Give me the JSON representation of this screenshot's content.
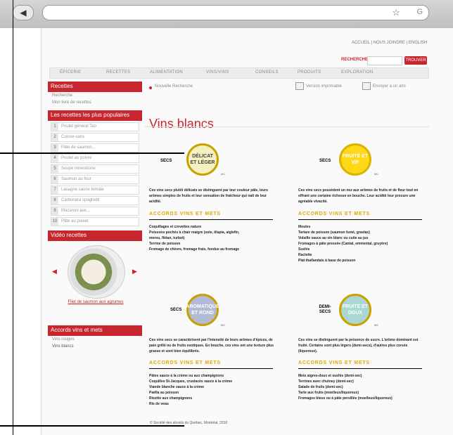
{
  "browser": {
    "back": "◀"
  },
  "header": {
    "lang": "ACCUEIL | NOUS JOINDRE | ENGLISH",
    "search_label": "RECHERCHE",
    "search_button": "TROUVER"
  },
  "nav": [
    "ÉPICERIE",
    "RECETTES",
    "ALIMENTATION",
    "VINS/VINS",
    "CONSEILS",
    "PRODUITS",
    "EXPLORATION"
  ],
  "sidebar": {
    "recettes": "Recettes",
    "links": [
      "Recherche",
      "Mon livre de recettes"
    ],
    "popular_head": "Les recettes les plus populaires",
    "popular": [
      "Poulet général Tao",
      "Cuisse-sans",
      "Pâté de saumon...",
      "Poulet au poivre",
      "Soupe minestrone",
      "Saumon au four",
      "Lasagne sauce tomate",
      "Carbonara spaghetti",
      "Macaroni aux...",
      "Pâté au poulet"
    ],
    "video_head": "Vidéo recettes",
    "video_caption": "Filet de saumon aux agrumes",
    "wines_head": "Accords vins et mets",
    "wines": [
      "Vins rouges",
      "Vins blancs"
    ]
  },
  "main": {
    "crumb": "Nouvelle Recherche",
    "print_label": "Version imprimable",
    "send_label": "Envoyer à un ami",
    "title": "Vins blancs",
    "cards": [
      {
        "type": "SECS",
        "circle": "DÉLICAT ET LÉGER",
        "circle_color": "#f5f0bf",
        "ring_color": "#c9a000",
        "text_color": "#444",
        "desc": "Ces vins secs plutôt délicats se distinguent par leur couleur pâle, leurs arômes simples de fruits et leur sensation de fraîcheur qui naît de leur acidité.",
        "section": "ACCORDS VINS ET METS",
        "items": [
          "Coquillages et crevettes nature",
          "Poissons pochés à chair maigre (sole, tilapia, aiglefin,",
          "merou, flétan, turbot)",
          "Terrine de poisson",
          "Fromage de chèvre, fromage frais, fondue au fromage"
        ]
      },
      {
        "type": "SECS",
        "circle": "FRUITÉ ET VIF",
        "circle_color": "#ffd81a",
        "ring_color": "#d9b400",
        "text_color": "#fff",
        "desc": "Ces vins secs possèdent un nez aux arômes de fruits et de fleur tout en offrant une certaine richesse en bouche. Leur acidité leur procure une agréable vivacité.",
        "section": "ACCORDS VINS ET METS",
        "items": [
          "Moules",
          "Tartare de poisson (saumon fumé, gravlax)",
          "Volaille sauce au vin blanc ou cuite au jus",
          "Fromages à pâte pressée (Cantal, emmental, gruyère)",
          "Sushis",
          "Raclette",
          "Plat thaïlandais à base de poisson"
        ]
      },
      {
        "type": "SECS",
        "circle": "AROMATIQUE ET ROND",
        "circle_color": "#b3bad6",
        "ring_color": "#c9a000",
        "text_color": "#fff",
        "desc": "Ces vins secs se caractérisent par l'intensité de leurs arômes d'épices, de pain grillé ou de fruits exotiques. En bouche, ces vins ont une texture plus grasse et sont bien équilibrés.",
        "section": "ACCORDS VINS ET METS",
        "items": [
          "Pâtes sauce à la crème ou aux champignons",
          "Coquilles St-Jacques, crustacés sauce à la crème",
          "Viande blanche sauce à la crème",
          "Paëlla au poisson",
          "Risotto aux champignons",
          "Ris de veau"
        ]
      },
      {
        "type": "DEMI-SECS",
        "circle": "FRUITÉ ET DOUX",
        "circle_color": "#a9d8d2",
        "ring_color": "#c9a000",
        "text_color": "#fff",
        "desc": "Ces vins se distinguent par la présence de sucre. L'arôme dominant est fruité. Certains sont plus légers (demi-secs), d'autres plus corsés (liquoreux).",
        "section": "ACCORDS VINS ET METS",
        "items": [
          "Mets aigres-doux et sushis (demi-sec)",
          "Terrines avec chutney (demi-sec)",
          "Salade de fruits (demi-sec)",
          "Tarte aux fruits (moelleux/liquoreux)",
          "Fromages bleus ou à pâte persillée (moelleux/liquoreux)"
        ]
      }
    ],
    "mini_mark": "MC",
    "footer": "© Société des alcools du Québec, Montréal, 2010"
  }
}
